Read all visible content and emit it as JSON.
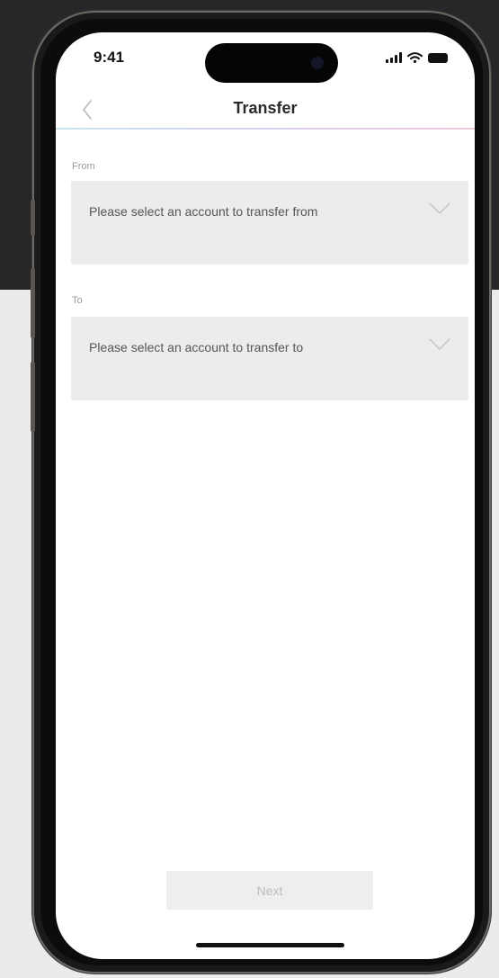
{
  "status_bar": {
    "time": "9:41",
    "icons": [
      "signal-icon",
      "wifi-icon",
      "battery-icon"
    ]
  },
  "nav": {
    "title": "Transfer",
    "back_icon": "chevron-left-icon"
  },
  "from": {
    "label": "From",
    "placeholder": "Please select an account to transfer from",
    "icon": "chevron-down-icon"
  },
  "to": {
    "label": "To",
    "placeholder": "Please select an account to transfer to",
    "icon": "chevron-down-icon"
  },
  "next_button": {
    "label": "Next",
    "enabled": false
  },
  "colors": {
    "backdrop_dark": "#262729",
    "backdrop_light": "#ebebec",
    "field_background": "#ececec",
    "button_disabled": "#eeeeee",
    "divider_gradient": [
      "#c9e4f0",
      "#d8d0ee",
      "#f0c8dc"
    ]
  }
}
